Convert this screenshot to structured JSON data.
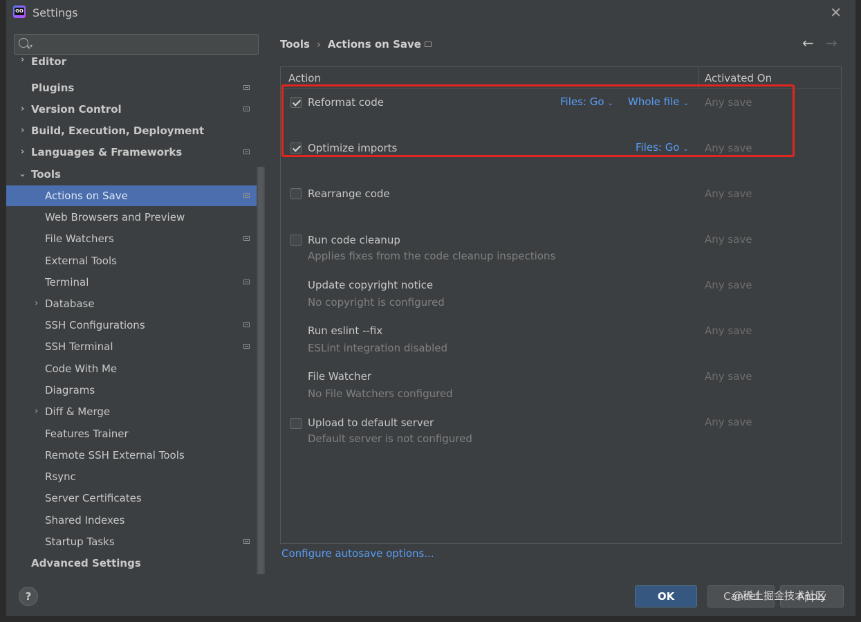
{
  "window": {
    "title": "Settings",
    "app_icon_text": "GO"
  },
  "search": {
    "placeholder": ""
  },
  "sidebar": {
    "items": [
      {
        "label": "Editor"
      },
      {
        "label": "Plugins"
      },
      {
        "label": "Version Control"
      },
      {
        "label": "Build, Execution, Deployment"
      },
      {
        "label": "Languages & Frameworks"
      },
      {
        "label": "Tools"
      },
      {
        "label": "Actions on Save"
      },
      {
        "label": "Web Browsers and Preview"
      },
      {
        "label": "File Watchers"
      },
      {
        "label": "External Tools"
      },
      {
        "label": "Terminal"
      },
      {
        "label": "Database"
      },
      {
        "label": "SSH Configurations"
      },
      {
        "label": "SSH Terminal"
      },
      {
        "label": "Code With Me"
      },
      {
        "label": "Diagrams"
      },
      {
        "label": "Diff & Merge"
      },
      {
        "label": "Features Trainer"
      },
      {
        "label": "Remote SSH External Tools"
      },
      {
        "label": "Rsync"
      },
      {
        "label": "Server Certificates"
      },
      {
        "label": "Shared Indexes"
      },
      {
        "label": "Startup Tasks"
      },
      {
        "label": "Advanced Settings"
      }
    ]
  },
  "breadcrumb": {
    "parent": "Tools",
    "separator": "›",
    "current": "Actions on Save"
  },
  "table": {
    "headers": {
      "action": "Action",
      "activated_on": "Activated On"
    },
    "rows": [
      {
        "label": "Reformat code",
        "checked": true,
        "sub": "",
        "files": "Files: Go",
        "scope": "Whole file",
        "when": "Any save"
      },
      {
        "label": "Optimize imports",
        "checked": true,
        "sub": "",
        "files": "Files: Go",
        "when": "Any save"
      },
      {
        "label": "Rearrange code",
        "checked": false,
        "sub": "",
        "when": "Any save"
      },
      {
        "label": "Run code cleanup",
        "checked": false,
        "sub": "Applies fixes from the code cleanup inspections",
        "when": "Any save"
      },
      {
        "label": "Update copyright notice",
        "sub": "No copyright is configured",
        "when": "Any save"
      },
      {
        "label": "Run eslint --fix",
        "sub": "ESLint integration disabled",
        "when": "Any save"
      },
      {
        "label": "File Watcher",
        "sub": "No File Watchers configured",
        "when": "Any save"
      },
      {
        "label": "Upload to default server",
        "checked": false,
        "sub": "Default server is not configured",
        "when": "Any save"
      }
    ]
  },
  "links": {
    "autosave": "Configure autosave options..."
  },
  "footer": {
    "help": "?",
    "ok": "OK",
    "cancel": "Cancel",
    "apply": "Apply",
    "watermark": "@稀土掘金技术社区"
  },
  "colors": {
    "accent": "#4b6eaf",
    "link": "#589df6",
    "highlight": "#e0261f",
    "ok_button": "#365880"
  }
}
